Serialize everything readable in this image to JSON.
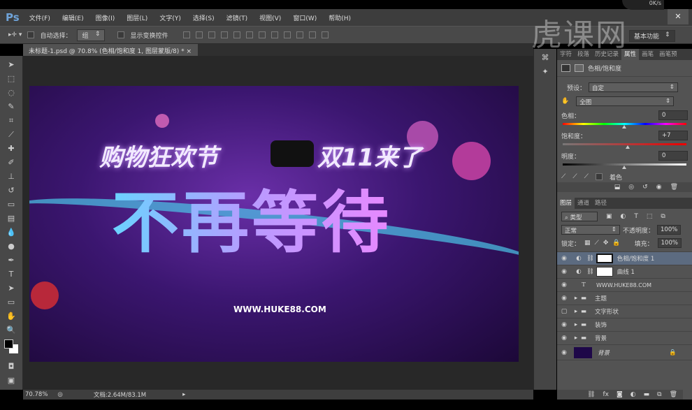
{
  "app": {
    "logo": "Ps",
    "menus": [
      "文件(F)",
      "编辑(E)",
      "图像(I)",
      "图层(L)",
      "文字(Y)",
      "选择(S)",
      "滤镜(T)",
      "视图(V)",
      "窗口(W)",
      "帮助(H)"
    ],
    "close": "✕",
    "net_speed": "0K/s",
    "watermark": "虎课网"
  },
  "options": {
    "auto_select_label": "自动选择：",
    "auto_select_value": "组",
    "show_transform": "显示变换控件",
    "workspace": "基本功能"
  },
  "document": {
    "tab_title": "未标题-1.psd @ 70.8% (色相/饱和度 1, 图层蒙版/8) *",
    "tab_close": "×"
  },
  "poster": {
    "line1": "购物狂欢节",
    "line2": "双11来了",
    "headline": "不再等待",
    "url": "WWW.HUKE88.COM"
  },
  "properties": {
    "tabs": [
      "字符",
      "段落",
      "历史记录",
      "属性",
      "画笔",
      "画笔预"
    ],
    "active_tab": 3,
    "title": "色相/饱和度",
    "preset_label": "预设：",
    "preset_value": "自定",
    "channel_value": "全图",
    "hue_label": "色相：",
    "hue_value": "0",
    "saturation_label": "饱和度：",
    "saturation_value": "+7",
    "lightness_label": "明度：",
    "lightness_value": "0",
    "colorize_label": "着色",
    "hue": 0,
    "saturation": 7,
    "lightness": 0
  },
  "layers": {
    "tabs": [
      "图层",
      "通道",
      "路径"
    ],
    "filter": "类型",
    "blend_mode": "正常",
    "opacity_label": "不透明度：",
    "opacity": "100%",
    "lock_label": "锁定：",
    "fill_label": "填充：",
    "fill": "100%",
    "items": [
      {
        "name": "色相/饱和度 1",
        "type": "adjustment",
        "visible": true,
        "selected": true
      },
      {
        "name": "曲线 1",
        "type": "adjustment",
        "visible": true
      },
      {
        "name": "WWW.HUKE88.COM",
        "type": "text",
        "visible": true
      },
      {
        "name": "主题",
        "type": "group",
        "visible": true
      },
      {
        "name": "文字形状",
        "type": "group",
        "visible": false
      },
      {
        "name": "装饰",
        "type": "group",
        "visible": true
      },
      {
        "name": "背景",
        "type": "group",
        "visible": true
      },
      {
        "name": "背景",
        "type": "background",
        "visible": true
      }
    ]
  },
  "status": {
    "zoom": "70.78%",
    "doc": "文档:2.64M/83.1M"
  }
}
